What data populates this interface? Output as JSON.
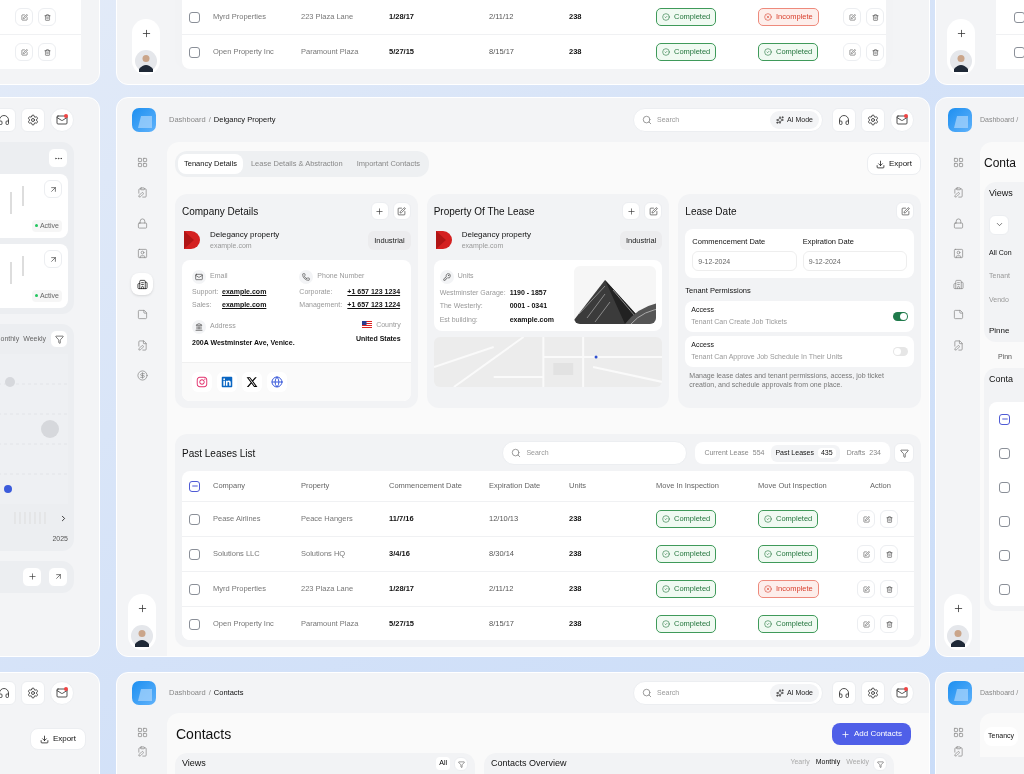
{
  "top_window": {
    "rows": [
      {
        "checked": false,
        "company": "Myrd Properties",
        "property": "223 Plaza Lane",
        "commencement": "1/28/17",
        "expiration": "2/11/12",
        "units": "238",
        "move_in": {
          "kind": "completed",
          "label": "Completed"
        },
        "move_out": {
          "kind": "incomplete",
          "label": "Incomplete"
        }
      },
      {
        "checked": false,
        "company": "Open Property Inc",
        "property": "Paramount Plaza",
        "commencement": "5/27/15",
        "expiration": "8/15/17",
        "units": "238",
        "move_in": {
          "kind": "completed",
          "label": "Completed"
        },
        "move_out": {
          "kind": "completed",
          "label": "Completed"
        }
      }
    ]
  },
  "top_right_window": {
    "checkboxes": [
      {
        "checked": false
      },
      {
        "checked": false
      }
    ]
  },
  "left_window": {
    "mail_unread": true,
    "badges": [
      "Active",
      "Active"
    ],
    "periods": [
      "onthly",
      "Weekly"
    ],
    "year": "2025"
  },
  "main": {
    "breadcrumb": {
      "parent": "Dashboard",
      "separator": "/",
      "current": "Delgancy Property"
    },
    "search": {
      "placeholder": "Search"
    },
    "ai_mode": "AI Mode",
    "mail_unread": true,
    "sidebar": [
      {
        "selected": false
      },
      {
        "selected": false
      },
      {
        "selected": false
      },
      {
        "selected": false
      },
      {
        "selected": true
      },
      {
        "selected": false
      },
      {
        "selected": false
      },
      {
        "selected": false
      }
    ],
    "tabs": [
      {
        "label": "Tenancy Details",
        "selected": true
      },
      {
        "label": "Lease Details & Abstraction",
        "selected": false
      },
      {
        "label": "Important Contacts",
        "selected": false
      }
    ],
    "export": "Export",
    "company": {
      "title": "Company Details",
      "name": "Delegancy property",
      "url": "example.com",
      "tag": "Industrial",
      "email": {
        "label": "Email",
        "rows": [
          {
            "label": "Support:",
            "value": "example.com"
          },
          {
            "label": "Sales:",
            "value": "example.com"
          }
        ]
      },
      "phone": {
        "label": "Phone Number",
        "rows": [
          {
            "label": "Corporate:",
            "value": "+1 657 123 1234"
          },
          {
            "label": "Management:",
            "value": "+1 657 123 1224"
          }
        ]
      },
      "address": {
        "label": "Address",
        "value": "200A Westminster Ave, Venice."
      },
      "country": {
        "label": "Country",
        "value": "United States"
      }
    },
    "property": {
      "title": "Property Of The Lease",
      "name": "Delegancy property",
      "url": "example.com",
      "tag": "Industrial",
      "units": {
        "label": "Units",
        "rows": [
          {
            "label": "Westminster Garage:",
            "value": "1190 - 1857"
          },
          {
            "label": "The Westerly:",
            "value": "0001 - 0341"
          },
          {
            "label": "Est building:",
            "value": "example.com"
          }
        ]
      }
    },
    "lease_date": {
      "title": "Lease Date",
      "fields": [
        {
          "label": "Commencement Date",
          "value": "9-12-2024"
        },
        {
          "label": "Expiration Date",
          "value": "9-12-2024"
        }
      ],
      "permissions_title": "Tenant Permissions",
      "permissions": [
        {
          "title": "Access",
          "description": "Tenant Can Create Job Tickets",
          "on": true
        },
        {
          "title": "Access",
          "description": "Tenant Can Approve Job Schedule In Their Units",
          "on": false
        }
      ],
      "note": "Manage lease dates and tenant permissions, access, job ticket creation, and schedule approvals from one place."
    },
    "past_leases": {
      "title": "Past Leases List",
      "search": {
        "placeholder": "Search"
      },
      "filters": [
        {
          "label": "Current Lease",
          "count": "554",
          "selected": false
        },
        {
          "label": "Past Leases",
          "count": "435",
          "selected": true
        },
        {
          "label": "Drafts",
          "count": "234",
          "selected": false
        }
      ],
      "columns": [
        "Company",
        "Property",
        "Commencement Date",
        "Expiration Date",
        "Units",
        "Move In Inspection",
        "Move Out Inspection",
        "Action"
      ],
      "header_checkbox": {
        "indeterminate": true
      },
      "rows": [
        {
          "checked": false,
          "company": "Pease Airlines",
          "property": "Peace Hangers",
          "commencement": "11/7/16",
          "expiration": "12/10/13",
          "units": "238",
          "move_in": {
            "kind": "completed",
            "label": "Completed"
          },
          "move_out": {
            "kind": "completed",
            "label": "Completed"
          }
        },
        {
          "checked": false,
          "company": "Solutions LLC",
          "property": "Solutions HQ",
          "commencement": "3/4/16",
          "expiration": "8/30/14",
          "units": "238",
          "move_in": {
            "kind": "completed",
            "label": "Completed"
          },
          "move_out": {
            "kind": "completed",
            "label": "Completed"
          }
        },
        {
          "checked": false,
          "company": "Myrd Properties",
          "property": "223 Plaza Lane",
          "commencement": "1/28/17",
          "expiration": "2/11/12",
          "units": "238",
          "move_in": {
            "kind": "completed",
            "label": "Completed"
          },
          "move_out": {
            "kind": "incomplete",
            "label": "Incomplete"
          }
        },
        {
          "checked": false,
          "company": "Open Property Inc",
          "property": "Paramount Plaza",
          "commencement": "5/27/15",
          "expiration": "8/15/17",
          "units": "238",
          "move_in": {
            "kind": "completed",
            "label": "Completed"
          },
          "move_out": {
            "kind": "completed",
            "label": "Completed"
          }
        }
      ]
    }
  },
  "right_window": {
    "breadcrumb": "Dashboard /",
    "title": "Conta",
    "views_title": "Views",
    "views_items": [
      "All Con",
      "Tenant",
      "Vendo"
    ],
    "pinned": "Pinne",
    "pinned_2": "Pinn",
    "contacts_title": "Conta",
    "checkboxes": [
      {
        "indeterminate": true
      },
      {
        "indeterminate": false
      },
      {
        "indeterminate": false
      },
      {
        "indeterminate": false
      },
      {
        "indeterminate": false
      },
      {
        "indeterminate": false
      }
    ]
  },
  "bottom_left_window": {
    "mail_unread": true,
    "export": "Export"
  },
  "bottom_window": {
    "breadcrumb": {
      "parent": "Dashboard",
      "separator": "/",
      "current": "Contacts"
    },
    "search": {
      "placeholder": "Search"
    },
    "ai_mode": "AI Mode",
    "mail_unread": true,
    "title": "Contacts",
    "add_button": "Add Contacts",
    "views": {
      "title": "Views",
      "filter": "All"
    },
    "overview": {
      "title": "Contacts Overview",
      "periods": [
        {
          "label": "Yearly",
          "selected": false
        },
        {
          "label": "Monthly",
          "selected": true
        },
        {
          "label": "Weekly",
          "selected": false
        }
      ]
    }
  },
  "bottom_right_window": {
    "breadcrumb": "Dashboard /",
    "tab": "Tenancy"
  }
}
